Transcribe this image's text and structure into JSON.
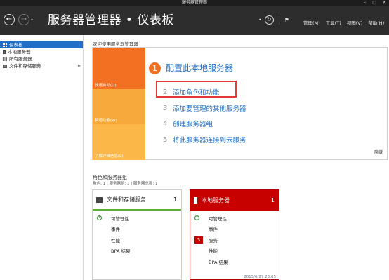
{
  "window": {
    "title": "服务器管理器"
  },
  "header": {
    "title": "服务器管理器 • 仪表板",
    "menu": [
      {
        "label": "管理(M)"
      },
      {
        "label": "工具(T)"
      },
      {
        "label": "视图(V)"
      },
      {
        "label": "帮助(H)"
      }
    ]
  },
  "sidebar": {
    "items": [
      {
        "label": "仪表板",
        "icon": "dashboard-icon",
        "active": true
      },
      {
        "label": "本地服务器",
        "icon": "server-icon"
      },
      {
        "label": "所有服务器",
        "icon": "servers-icon"
      },
      {
        "label": "文件和存储服务",
        "icon": "storage-icon"
      }
    ]
  },
  "welcome": {
    "label": "欢迎使用服务器管理器",
    "tiles": [
      {
        "label": "快速启动(Q)"
      },
      {
        "label": "新增功能(W)"
      },
      {
        "label": "了解详细信息(L)"
      }
    ],
    "step1": {
      "number": "1",
      "title": "配置此本地服务器"
    },
    "steps": [
      {
        "number": "2",
        "label": "添加角色和功能"
      },
      {
        "number": "3",
        "label": "添加要管理的其他服务器"
      },
      {
        "number": "4",
        "label": "创建服务器组"
      },
      {
        "number": "5",
        "label": "将此服务器连接到云服务"
      }
    ],
    "hide_label": "隐藏"
  },
  "roles": {
    "title": "角色和服务器组",
    "subtitle": "角色: 1 | 服务器组: 1 | 服务器总数: 1",
    "cards": [
      {
        "title": "文件和存储服务",
        "count": "1",
        "rows": [
          {
            "label": "可管理性",
            "status": "ok"
          },
          {
            "label": "事件"
          },
          {
            "label": "性能"
          },
          {
            "label": "BPA 结果"
          }
        ]
      },
      {
        "title": "本地服务器",
        "count": "1",
        "rows": [
          {
            "label": "可管理性",
            "status": "ok"
          },
          {
            "label": "事件"
          },
          {
            "label": "服务",
            "badge": "3"
          },
          {
            "label": "性能"
          },
          {
            "label": "BPA 结果"
          }
        ],
        "timestamp": "2015/6/27 23:05"
      }
    ]
  },
  "colors": {
    "accent": "#1f6fc6",
    "tile_orange": "#f36f21",
    "tile_amber": "#f7a93b",
    "alert_red": "#c70000",
    "highlight": "#e23b35",
    "ok_green": "#5cb038"
  }
}
